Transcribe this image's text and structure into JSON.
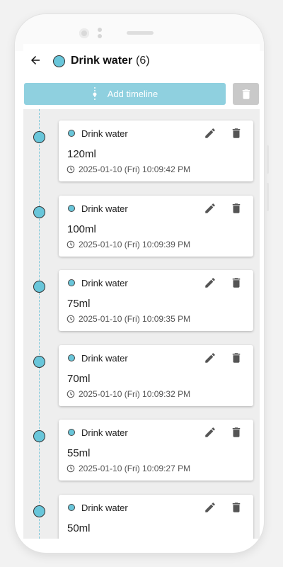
{
  "header": {
    "title": "Drink water",
    "count": "(6)"
  },
  "toolbar": {
    "add_label": "Add timeline"
  },
  "colors": {
    "accent": "#69c6da",
    "add_button": "#8fd0df",
    "delete_all_button": "#c9c9c9"
  },
  "icons": {
    "back": "arrow-left-icon",
    "timeline": "timeline-icon",
    "delete": "trash-icon",
    "edit": "pencil-icon",
    "time": "clock-icon"
  },
  "entries": [
    {
      "name": "Drink water",
      "amount": "120ml",
      "time": "2025-01-10 (Fri) 10:09:42 PM"
    },
    {
      "name": "Drink water",
      "amount": "100ml",
      "time": "2025-01-10 (Fri) 10:09:39 PM"
    },
    {
      "name": "Drink water",
      "amount": "75ml",
      "time": "2025-01-10 (Fri) 10:09:35 PM"
    },
    {
      "name": "Drink water",
      "amount": "70ml",
      "time": "2025-01-10 (Fri) 10:09:32 PM"
    },
    {
      "name": "Drink water",
      "amount": "55ml",
      "time": "2025-01-10 (Fri) 10:09:27 PM"
    },
    {
      "name": "Drink water",
      "amount": "50ml",
      "time": ""
    }
  ]
}
